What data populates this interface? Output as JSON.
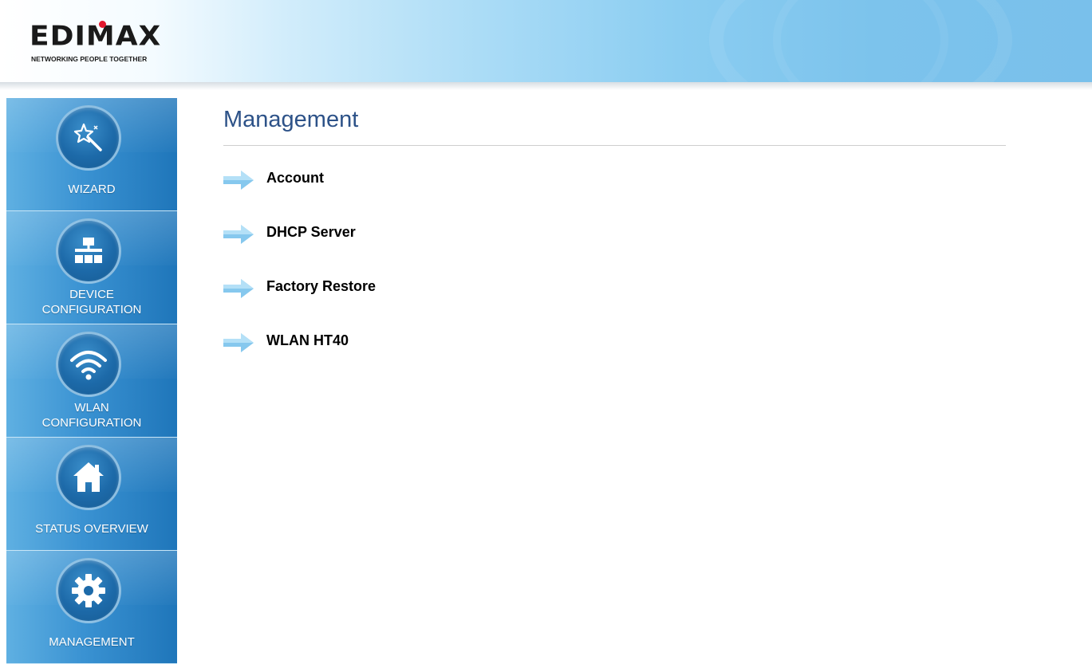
{
  "brand": {
    "name": "EDIMAX",
    "tagline": "NETWORKING PEOPLE TOGETHER",
    "dot_color": "#e1172d"
  },
  "sidebar": {
    "items": [
      {
        "id": "wizard",
        "label": "WIZARD",
        "icon": "magic-wand-icon"
      },
      {
        "id": "device",
        "label_line1": "DEVICE",
        "label_line2": "CONFIGURATION",
        "icon": "network-icon"
      },
      {
        "id": "wlan",
        "label_line1": "WLAN",
        "label_line2": "CONFIGURATION",
        "icon": "wifi-icon"
      },
      {
        "id": "status",
        "label": "STATUS OVERVIEW",
        "icon": "home-icon"
      },
      {
        "id": "management",
        "label": "MANAGEMENT",
        "icon": "gear-icon"
      }
    ]
  },
  "main": {
    "title": "Management",
    "links": [
      {
        "label": "Account"
      },
      {
        "label": "DHCP Server"
      },
      {
        "label": "Factory Restore"
      },
      {
        "label": "WLAN HT40"
      }
    ]
  },
  "colors": {
    "title": "#2d5288",
    "sidebar_gradient": [
      "#5fb0e2",
      "#1f76ba"
    ],
    "arrow": "#7fc4ec"
  }
}
